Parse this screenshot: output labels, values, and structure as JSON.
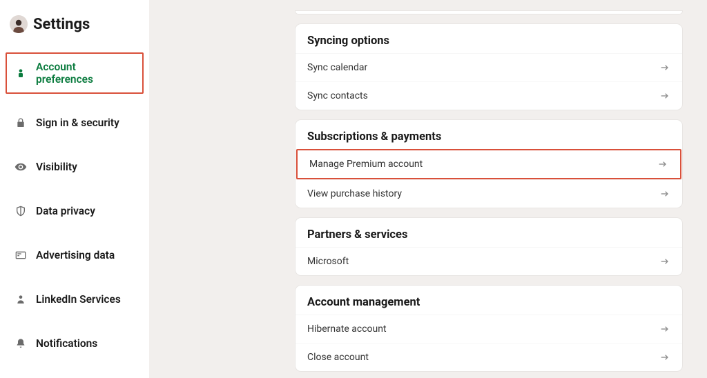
{
  "header": {
    "title": "Settings"
  },
  "sidebar": {
    "items": [
      {
        "label": "Account preferences",
        "icon": "person-icon",
        "active": true
      },
      {
        "label": "Sign in & security",
        "icon": "lock-icon"
      },
      {
        "label": "Visibility",
        "icon": "eye-icon"
      },
      {
        "label": "Data privacy",
        "icon": "shield-icon"
      },
      {
        "label": "Advertising data",
        "icon": "ad-icon"
      },
      {
        "label": "LinkedIn Services",
        "icon": "person-small-icon"
      },
      {
        "label": "Notifications",
        "icon": "bell-icon"
      }
    ]
  },
  "sections": {
    "syncing": {
      "heading": "Syncing options",
      "rows": [
        {
          "label": "Sync calendar"
        },
        {
          "label": "Sync contacts"
        }
      ]
    },
    "subs": {
      "heading": "Subscriptions & payments",
      "rows": [
        {
          "label": "Manage Premium account",
          "highlight": true
        },
        {
          "label": "View purchase history"
        }
      ]
    },
    "partners": {
      "heading": "Partners & services",
      "rows": [
        {
          "label": "Microsoft"
        }
      ]
    },
    "account": {
      "heading": "Account management",
      "rows": [
        {
          "label": "Hibernate account"
        },
        {
          "label": "Close account"
        }
      ]
    }
  }
}
